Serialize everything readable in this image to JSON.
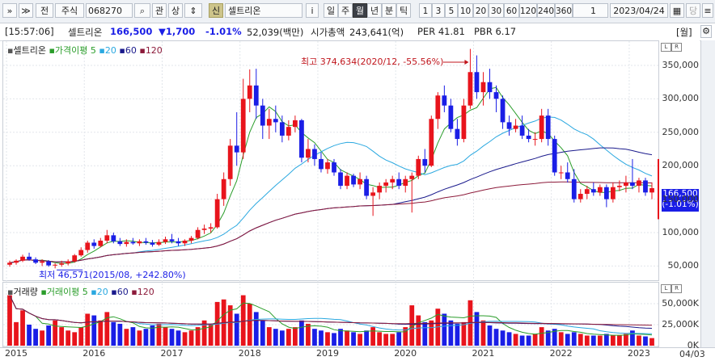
{
  "toolbar": {
    "nav_expand": "»",
    "nav_down": "≫",
    "tab_jeon": "전",
    "category": "주식",
    "code": "068270",
    "kwan": "관",
    "sang": "상",
    "shin_badge": "신",
    "stock_name": "셀트리온",
    "info_btn": "i",
    "periods": [
      "일",
      "주",
      "월",
      "년",
      "분",
      "틱"
    ],
    "selected_period": "월",
    "intervals": [
      "1",
      "3",
      "5",
      "10",
      "20",
      "30",
      "60",
      "120",
      "240",
      "360"
    ],
    "count": "1",
    "date": "2023/04/24",
    "dang": "당"
  },
  "infobar": {
    "time": "[15:57:06]",
    "name": "셀트리온",
    "price": "166,500",
    "change": "▼1,700",
    "change_pct": "-1.01%",
    "volume": "52,039(백만)",
    "market_cap_label": "시가총액",
    "market_cap": "243,641(억)",
    "per": "PER 41.81",
    "pbr": "PBR 6.17",
    "unit_btn": "[월]"
  },
  "price_panel": {
    "legend": {
      "name": "셀트리온",
      "ma_label": "가격이평",
      "ma_periods": [
        "5",
        "20",
        "60",
        "120"
      ]
    },
    "annotation_high": "최고 374,634(2020/12, -55.56%)",
    "annotation_low": "최저 46,571(2015/08, +242.80%)",
    "current_label": "166,500",
    "current_pct": "(-1.01%)"
  },
  "volume_panel": {
    "legend": {
      "name": "거래량",
      "ma_label": "거래이평",
      "ma_periods": [
        "5",
        "20",
        "60",
        "120"
      ]
    }
  },
  "xaxis_date": "04/03",
  "colors": {
    "up": "#e8141c",
    "down": "#1a1ee6",
    "ma5": "#2a9d2a",
    "ma20": "#2aa8e0",
    "ma60": "#1a1a8c",
    "ma120": "#8c1a3a"
  },
  "chart_data": [
    {
      "type": "candlestick",
      "title": "셀트리온",
      "interval": "monthly",
      "x_ticks": [
        "2015",
        "2016",
        "2017",
        "2018",
        "2019",
        "2020",
        "2021",
        "2022",
        "2023"
      ],
      "y_ticks": [
        50000,
        100000,
        150000,
        200000,
        250000,
        300000,
        350000
      ],
      "y_tick_labels": [
        "50,000",
        "100,000",
        "150,000",
        "200,000",
        "250,000",
        "300,000",
        "350,000"
      ],
      "ylim": [
        30000,
        385000
      ],
      "grid": true,
      "candles": [
        {
          "t": "2015-01",
          "o": 52000,
          "h": 58000,
          "l": 49000,
          "c": 55000
        },
        {
          "t": "2015-02",
          "o": 55000,
          "h": 60000,
          "l": 52000,
          "c": 58000
        },
        {
          "t": "2015-03",
          "o": 58000,
          "h": 67000,
          "l": 56000,
          "c": 64000
        },
        {
          "t": "2015-04",
          "o": 64000,
          "h": 70000,
          "l": 58000,
          "c": 60000
        },
        {
          "t": "2015-05",
          "o": 60000,
          "h": 63000,
          "l": 53000,
          "c": 55000
        },
        {
          "t": "2015-06",
          "o": 55000,
          "h": 60000,
          "l": 50000,
          "c": 57000
        },
        {
          "t": "2015-07",
          "o": 57000,
          "h": 59000,
          "l": 49000,
          "c": 51000
        },
        {
          "t": "2015-08",
          "o": 51000,
          "h": 54000,
          "l": 46571,
          "c": 52000
        },
        {
          "t": "2015-09",
          "o": 52000,
          "h": 58000,
          "l": 49000,
          "c": 54000
        },
        {
          "t": "2015-10",
          "o": 54000,
          "h": 60000,
          "l": 51000,
          "c": 57000
        },
        {
          "t": "2015-11",
          "o": 57000,
          "h": 68000,
          "l": 55000,
          "c": 66000
        },
        {
          "t": "2015-12",
          "o": 66000,
          "h": 78000,
          "l": 64000,
          "c": 74000
        },
        {
          "t": "2016-01",
          "o": 74000,
          "h": 88000,
          "l": 70000,
          "c": 85000
        },
        {
          "t": "2016-02",
          "o": 85000,
          "h": 90000,
          "l": 76000,
          "c": 80000
        },
        {
          "t": "2016-03",
          "o": 80000,
          "h": 92000,
          "l": 78000,
          "c": 88000
        },
        {
          "t": "2016-04",
          "o": 88000,
          "h": 104000,
          "l": 84000,
          "c": 96000
        },
        {
          "t": "2016-05",
          "o": 96000,
          "h": 100000,
          "l": 84000,
          "c": 87000
        },
        {
          "t": "2016-06",
          "o": 87000,
          "h": 92000,
          "l": 80000,
          "c": 83000
        },
        {
          "t": "2016-07",
          "o": 83000,
          "h": 90000,
          "l": 79000,
          "c": 86000
        },
        {
          "t": "2016-08",
          "o": 86000,
          "h": 92000,
          "l": 82000,
          "c": 84000
        },
        {
          "t": "2016-09",
          "o": 84000,
          "h": 90000,
          "l": 80000,
          "c": 87000
        },
        {
          "t": "2016-10",
          "o": 87000,
          "h": 92000,
          "l": 82000,
          "c": 85000
        },
        {
          "t": "2016-11",
          "o": 85000,
          "h": 89000,
          "l": 79000,
          "c": 82000
        },
        {
          "t": "2016-12",
          "o": 82000,
          "h": 90000,
          "l": 80000,
          "c": 86000
        },
        {
          "t": "2017-01",
          "o": 86000,
          "h": 94000,
          "l": 83000,
          "c": 90000
        },
        {
          "t": "2017-02",
          "o": 90000,
          "h": 98000,
          "l": 84000,
          "c": 87000
        },
        {
          "t": "2017-03",
          "o": 87000,
          "h": 92000,
          "l": 80000,
          "c": 84000
        },
        {
          "t": "2017-04",
          "o": 84000,
          "h": 90000,
          "l": 80000,
          "c": 88000
        },
        {
          "t": "2017-05",
          "o": 88000,
          "h": 95000,
          "l": 84000,
          "c": 92000
        },
        {
          "t": "2017-06",
          "o": 92000,
          "h": 108000,
          "l": 90000,
          "c": 104000
        },
        {
          "t": "2017-07",
          "o": 104000,
          "h": 112000,
          "l": 98000,
          "c": 106000
        },
        {
          "t": "2017-08",
          "o": 106000,
          "h": 114000,
          "l": 100000,
          "c": 108000
        },
        {
          "t": "2017-09",
          "o": 108000,
          "h": 158000,
          "l": 106000,
          "c": 150000
        },
        {
          "t": "2017-10",
          "o": 150000,
          "h": 190000,
          "l": 140000,
          "c": 180000
        },
        {
          "t": "2017-11",
          "o": 180000,
          "h": 240000,
          "l": 170000,
          "c": 230000
        },
        {
          "t": "2017-12",
          "o": 230000,
          "h": 280000,
          "l": 200000,
          "c": 220000
        },
        {
          "t": "2018-01",
          "o": 220000,
          "h": 330000,
          "l": 210000,
          "c": 300000
        },
        {
          "t": "2018-02",
          "o": 300000,
          "h": 344000,
          "l": 280000,
          "c": 320000
        },
        {
          "t": "2018-03",
          "o": 320000,
          "h": 345000,
          "l": 270000,
          "c": 290000
        },
        {
          "t": "2018-04",
          "o": 290000,
          "h": 300000,
          "l": 240000,
          "c": 260000
        },
        {
          "t": "2018-05",
          "o": 260000,
          "h": 285000,
          "l": 240000,
          "c": 270000
        },
        {
          "t": "2018-06",
          "o": 270000,
          "h": 290000,
          "l": 250000,
          "c": 265000
        },
        {
          "t": "2018-07",
          "o": 265000,
          "h": 275000,
          "l": 235000,
          "c": 245000
        },
        {
          "t": "2018-08",
          "o": 245000,
          "h": 268000,
          "l": 238000,
          "c": 258000
        },
        {
          "t": "2018-09",
          "o": 258000,
          "h": 275000,
          "l": 250000,
          "c": 268000
        },
        {
          "t": "2018-10",
          "o": 268000,
          "h": 270000,
          "l": 205000,
          "c": 212000
        },
        {
          "t": "2018-11",
          "o": 212000,
          "h": 240000,
          "l": 205000,
          "c": 225000
        },
        {
          "t": "2018-12",
          "o": 225000,
          "h": 232000,
          "l": 200000,
          "c": 210000
        },
        {
          "t": "2019-01",
          "o": 210000,
          "h": 220000,
          "l": 190000,
          "c": 195000
        },
        {
          "t": "2019-02",
          "o": 195000,
          "h": 210000,
          "l": 188000,
          "c": 205000
        },
        {
          "t": "2019-03",
          "o": 205000,
          "h": 210000,
          "l": 185000,
          "c": 190000
        },
        {
          "t": "2019-04",
          "o": 190000,
          "h": 195000,
          "l": 165000,
          "c": 170000
        },
        {
          "t": "2019-05",
          "o": 170000,
          "h": 190000,
          "l": 165000,
          "c": 185000
        },
        {
          "t": "2019-06",
          "o": 185000,
          "h": 188000,
          "l": 168000,
          "c": 172000
        },
        {
          "t": "2019-07",
          "o": 172000,
          "h": 190000,
          "l": 165000,
          "c": 180000
        },
        {
          "t": "2019-08",
          "o": 180000,
          "h": 185000,
          "l": 150000,
          "c": 155000
        },
        {
          "t": "2019-09",
          "o": 155000,
          "h": 168000,
          "l": 125000,
          "c": 160000
        },
        {
          "t": "2019-10",
          "o": 160000,
          "h": 175000,
          "l": 150000,
          "c": 170000
        },
        {
          "t": "2019-11",
          "o": 170000,
          "h": 180000,
          "l": 160000,
          "c": 175000
        },
        {
          "t": "2019-12",
          "o": 175000,
          "h": 185000,
          "l": 165000,
          "c": 180000
        },
        {
          "t": "2020-01",
          "o": 180000,
          "h": 190000,
          "l": 165000,
          "c": 170000
        },
        {
          "t": "2020-02",
          "o": 170000,
          "h": 185000,
          "l": 160000,
          "c": 180000
        },
        {
          "t": "2020-03",
          "o": 180000,
          "h": 190000,
          "l": 130000,
          "c": 185000
        },
        {
          "t": "2020-04",
          "o": 185000,
          "h": 215000,
          "l": 180000,
          "c": 210000
        },
        {
          "t": "2020-05",
          "o": 210000,
          "h": 225000,
          "l": 190000,
          "c": 200000
        },
        {
          "t": "2020-06",
          "o": 200000,
          "h": 275000,
          "l": 198000,
          "c": 270000
        },
        {
          "t": "2020-07",
          "o": 270000,
          "h": 310000,
          "l": 255000,
          "c": 305000
        },
        {
          "t": "2020-08",
          "o": 305000,
          "h": 320000,
          "l": 280000,
          "c": 290000
        },
        {
          "t": "2020-09",
          "o": 290000,
          "h": 300000,
          "l": 250000,
          "c": 255000
        },
        {
          "t": "2020-10",
          "o": 255000,
          "h": 270000,
          "l": 230000,
          "c": 240000
        },
        {
          "t": "2020-11",
          "o": 240000,
          "h": 300000,
          "l": 235000,
          "c": 290000
        },
        {
          "t": "2020-12",
          "o": 290000,
          "h": 374634,
          "l": 285000,
          "c": 340000
        },
        {
          "t": "2021-01",
          "o": 340000,
          "h": 365000,
          "l": 300000,
          "c": 310000
        },
        {
          "t": "2021-02",
          "o": 310000,
          "h": 340000,
          "l": 290000,
          "c": 325000
        },
        {
          "t": "2021-03",
          "o": 325000,
          "h": 345000,
          "l": 300000,
          "c": 310000
        },
        {
          "t": "2021-04",
          "o": 310000,
          "h": 320000,
          "l": 280000,
          "c": 300000
        },
        {
          "t": "2021-05",
          "o": 300000,
          "h": 305000,
          "l": 255000,
          "c": 265000
        },
        {
          "t": "2021-06",
          "o": 265000,
          "h": 275000,
          "l": 245000,
          "c": 255000
        },
        {
          "t": "2021-07",
          "o": 255000,
          "h": 270000,
          "l": 250000,
          "c": 260000
        },
        {
          "t": "2021-08",
          "o": 260000,
          "h": 275000,
          "l": 240000,
          "c": 245000
        },
        {
          "t": "2021-09",
          "o": 245000,
          "h": 255000,
          "l": 235000,
          "c": 240000
        },
        {
          "t": "2021-10",
          "o": 240000,
          "h": 250000,
          "l": 230000,
          "c": 240000
        },
        {
          "t": "2021-11",
          "o": 240000,
          "h": 285000,
          "l": 235000,
          "c": 275000
        },
        {
          "t": "2021-12",
          "o": 275000,
          "h": 285000,
          "l": 230000,
          "c": 240000
        },
        {
          "t": "2022-01",
          "o": 240000,
          "h": 245000,
          "l": 185000,
          "c": 190000
        },
        {
          "t": "2022-02",
          "o": 190000,
          "h": 200000,
          "l": 180000,
          "c": 190000
        },
        {
          "t": "2022-03",
          "o": 190000,
          "h": 205000,
          "l": 175000,
          "c": 180000
        },
        {
          "t": "2022-04",
          "o": 180000,
          "h": 195000,
          "l": 145000,
          "c": 150000
        },
        {
          "t": "2022-05",
          "o": 150000,
          "h": 165000,
          "l": 145000,
          "c": 158000
        },
        {
          "t": "2022-06",
          "o": 158000,
          "h": 170000,
          "l": 150000,
          "c": 165000
        },
        {
          "t": "2022-07",
          "o": 165000,
          "h": 175000,
          "l": 155000,
          "c": 160000
        },
        {
          "t": "2022-08",
          "o": 160000,
          "h": 172000,
          "l": 155000,
          "c": 168000
        },
        {
          "t": "2022-09",
          "o": 168000,
          "h": 172000,
          "l": 138000,
          "c": 150000
        },
        {
          "t": "2022-10",
          "o": 150000,
          "h": 175000,
          "l": 145000,
          "c": 168000
        },
        {
          "t": "2022-11",
          "o": 168000,
          "h": 178000,
          "l": 162000,
          "c": 170000
        },
        {
          "t": "2022-12",
          "o": 170000,
          "h": 185000,
          "l": 160000,
          "c": 175000
        },
        {
          "t": "2023-01",
          "o": 175000,
          "h": 210000,
          "l": 165000,
          "c": 170000
        },
        {
          "t": "2023-02",
          "o": 170000,
          "h": 182000,
          "l": 160000,
          "c": 178000
        },
        {
          "t": "2023-03",
          "o": 178000,
          "h": 182000,
          "l": 155000,
          "c": 160000
        },
        {
          "t": "2023-04",
          "o": 160000,
          "h": 175000,
          "l": 150000,
          "c": 166500
        }
      ]
    },
    {
      "type": "bar",
      "title": "거래량",
      "y_ticks": [
        0,
        25000,
        50000
      ],
      "y_tick_labels": [
        "0K",
        "25,000K",
        "50,000K"
      ],
      "ylim": [
        0,
        74000
      ],
      "grid": true,
      "volumes_thousands": [
        60000,
        28000,
        42000,
        25000,
        20000,
        18000,
        24000,
        30000,
        22000,
        18000,
        16000,
        22000,
        38000,
        36000,
        30000,
        40000,
        28000,
        26000,
        20000,
        22000,
        18000,
        20000,
        24000,
        26000,
        22000,
        20000,
        18000,
        16000,
        18000,
        22000,
        30000,
        26000,
        52000,
        55000,
        48000,
        38000,
        60000,
        50000,
        40000,
        30000,
        22000,
        20000,
        18000,
        20000,
        22000,
        30000,
        26000,
        20000,
        18000,
        16000,
        15000,
        20000,
        18000,
        16000,
        14000,
        18000,
        22000,
        16000,
        14000,
        14000,
        16000,
        22000,
        48000,
        36000,
        28000,
        30000,
        44000,
        38000,
        30000,
        26000,
        28000,
        54000,
        40000,
        30000,
        24000,
        20000,
        18000,
        16000,
        14000,
        12000,
        12000,
        14000,
        22000,
        18000,
        20000,
        16000,
        14000,
        16000,
        14000,
        12000,
        12000,
        12000,
        14000,
        12000,
        12000,
        14000,
        18000,
        12000,
        11000,
        9000
      ]
    }
  ]
}
